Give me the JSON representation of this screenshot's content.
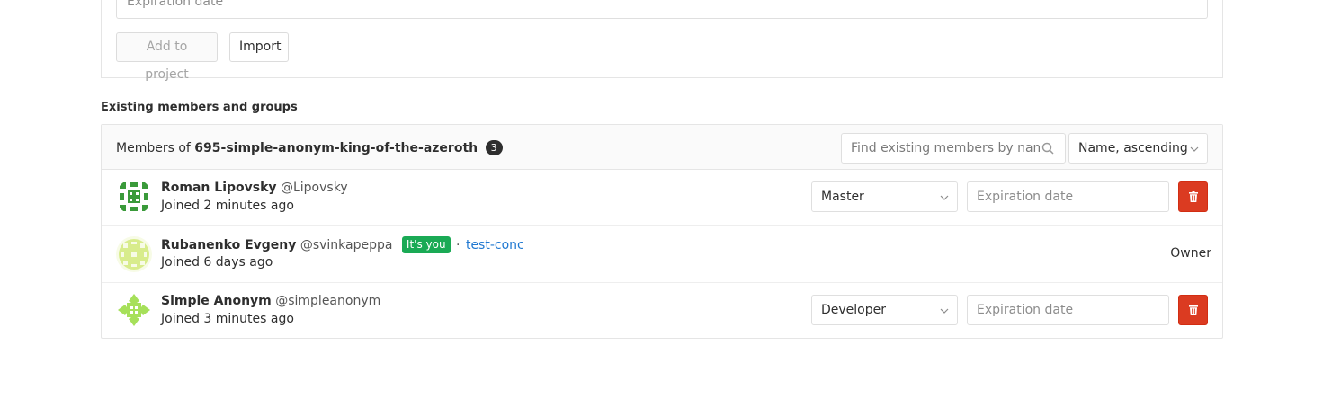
{
  "add_form": {
    "expiration_placeholder": "Expiration date",
    "add_button_label": "Add to project",
    "import_button_label": "Import"
  },
  "section_title": "Existing members and groups",
  "members_header": {
    "members_of_prefix": "Members of",
    "project_name": "695-simple-anonym-king-of-the-azeroth",
    "count": "3",
    "search_placeholder": "Find existing members by name",
    "sort_value": "Name, ascending"
  },
  "members": [
    {
      "name": "Roman Lipovsky",
      "username": "@Lipovsky",
      "joined": "Joined 2 minutes ago",
      "role": "Master",
      "expiration_placeholder": "Expiration date"
    },
    {
      "name": "Rubanenko Evgeny",
      "username": "@svinkapeppa",
      "badge": "It's you",
      "separator": "·",
      "group": "test-conc",
      "joined": "Joined 6 days ago",
      "role": "Owner"
    },
    {
      "name": "Simple Anonym",
      "username": "@simpleanonym",
      "joined": "Joined 3 minutes ago",
      "role": "Developer",
      "expiration_placeholder": "Expiration date"
    }
  ],
  "colors": {
    "danger": "#db3b21",
    "success_badge": "#1aaa55",
    "link": "#1f78d1",
    "count_badge": "#2e2e2e"
  },
  "icons": {
    "search": "search-icon",
    "chevron": "chevron-down-icon",
    "delete": "trash-icon"
  }
}
